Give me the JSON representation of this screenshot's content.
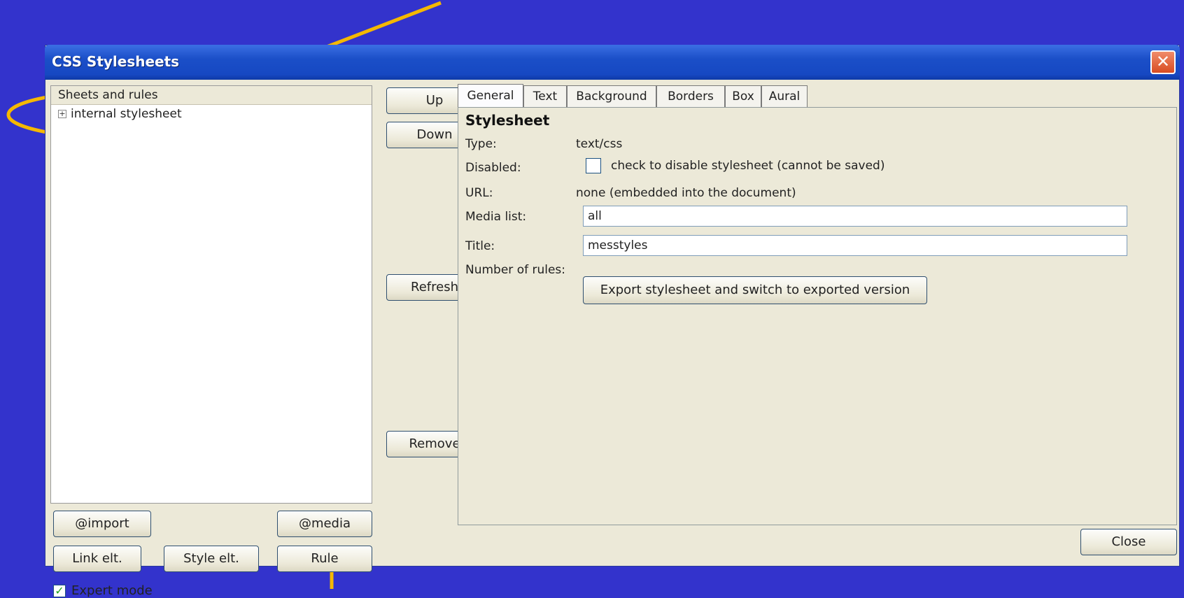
{
  "window": {
    "title": "CSS Stylesheets",
    "close_glyph": "✕"
  },
  "left_panel": {
    "tree_header": "Sheets and rules",
    "tree_items": [
      {
        "expander": "+",
        "label": "internal stylesheet"
      }
    ],
    "buttons": {
      "import": "@import",
      "media": "@media",
      "link_elt": "Link elt.",
      "style_elt": "Style elt.",
      "rule": "Rule"
    },
    "expert_mode": {
      "label": "Expert mode",
      "checked": true,
      "check_glyph": "✓"
    }
  },
  "middle_buttons": {
    "up": "Up",
    "down": "Down",
    "refresh": "Refresh",
    "remove": "Remove"
  },
  "tabs": [
    "General",
    "Text",
    "Background",
    "Borders",
    "Box",
    "Aural"
  ],
  "active_tab": "General",
  "general": {
    "heading": "Stylesheet",
    "type_label": "Type:",
    "type_value": "text/css",
    "disabled_label": "Disabled:",
    "disabled_checkbox_text": "check to disable stylesheet (cannot be saved)",
    "url_label": "URL:",
    "url_value": "none (embedded into the document)",
    "media_label": "Media list:",
    "media_value": "all",
    "title_label": "Title:",
    "title_value": "messtyles",
    "rules_label": "Number of rules:",
    "export_button": "Export stylesheet and switch to exported version"
  },
  "footer": {
    "close_button": "Close"
  },
  "colors": {
    "background": "#3333cc",
    "annotation": "#f5b800",
    "titlebar": "#1b4fc8",
    "dialog": "#ece9d8"
  }
}
